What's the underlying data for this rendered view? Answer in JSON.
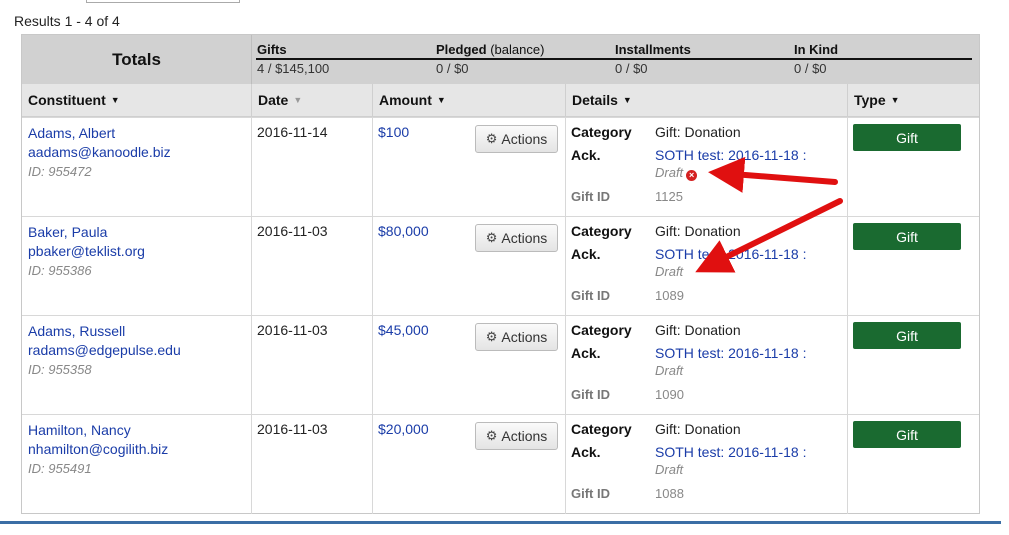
{
  "results": {
    "text": "Results 1 - 4 of 4"
  },
  "totals": {
    "label": "Totals",
    "gifts": {
      "title": "Gifts",
      "value": "4 / $145,100"
    },
    "pledged": {
      "title": "Pledged",
      "sub": "(balance)",
      "value": "0 / $0"
    },
    "installments": {
      "title": "Installments",
      "value": "0 / $0"
    },
    "inkind": {
      "title": "In Kind",
      "value": "0 / $0"
    }
  },
  "columns": {
    "constituent": "Constituent",
    "date": "Date",
    "amount": "Amount",
    "details": "Details",
    "type": "Type"
  },
  "labels": {
    "actions": "Actions",
    "category": "Category",
    "ack": "Ack.",
    "gift_id": "Gift ID",
    "draft": "Draft"
  },
  "rows": [
    {
      "name": "Adams, Albert",
      "email": "aadams@kanoodle.biz",
      "id": "ID: 955472",
      "date": "2016-11-14",
      "amount": "$100",
      "category": "Gift: Donation",
      "ack": "SOTH test: 2016-11-18 :",
      "gift_id": "1125",
      "type": "Gift"
    },
    {
      "name": "Baker, Paula",
      "email": "pbaker@teklist.org",
      "id": "ID: 955386",
      "date": "2016-11-03",
      "amount": "$80,000",
      "category": "Gift: Donation",
      "ack": "SOTH test: 2016-11-18 :",
      "gift_id": "1089",
      "type": "Gift"
    },
    {
      "name": "Adams, Russell",
      "email": "radams@edgepulse.edu",
      "id": "ID: 955358",
      "date": "2016-11-03",
      "amount": "$45,000",
      "category": "Gift: Donation",
      "ack": "SOTH test: 2016-11-18 :",
      "gift_id": "1090",
      "type": "Gift"
    },
    {
      "name": "Hamilton, Nancy",
      "email": "nhamilton@cogilith.biz",
      "id": "ID: 955491",
      "date": "2016-11-03",
      "amount": "$20,000",
      "category": "Gift: Donation",
      "ack": "SOTH test: 2016-11-18 :",
      "gift_id": "1088",
      "type": "Gift"
    }
  ],
  "colors": {
    "link": "#1a3ca8",
    "gift_button": "#1a6a30",
    "arrow": "#e01010",
    "header_bg": "#d1d1d1"
  },
  "icons": {
    "actions": "gear-icon",
    "ack_error": "error-x-icon",
    "sort": "caret-down-icon"
  }
}
